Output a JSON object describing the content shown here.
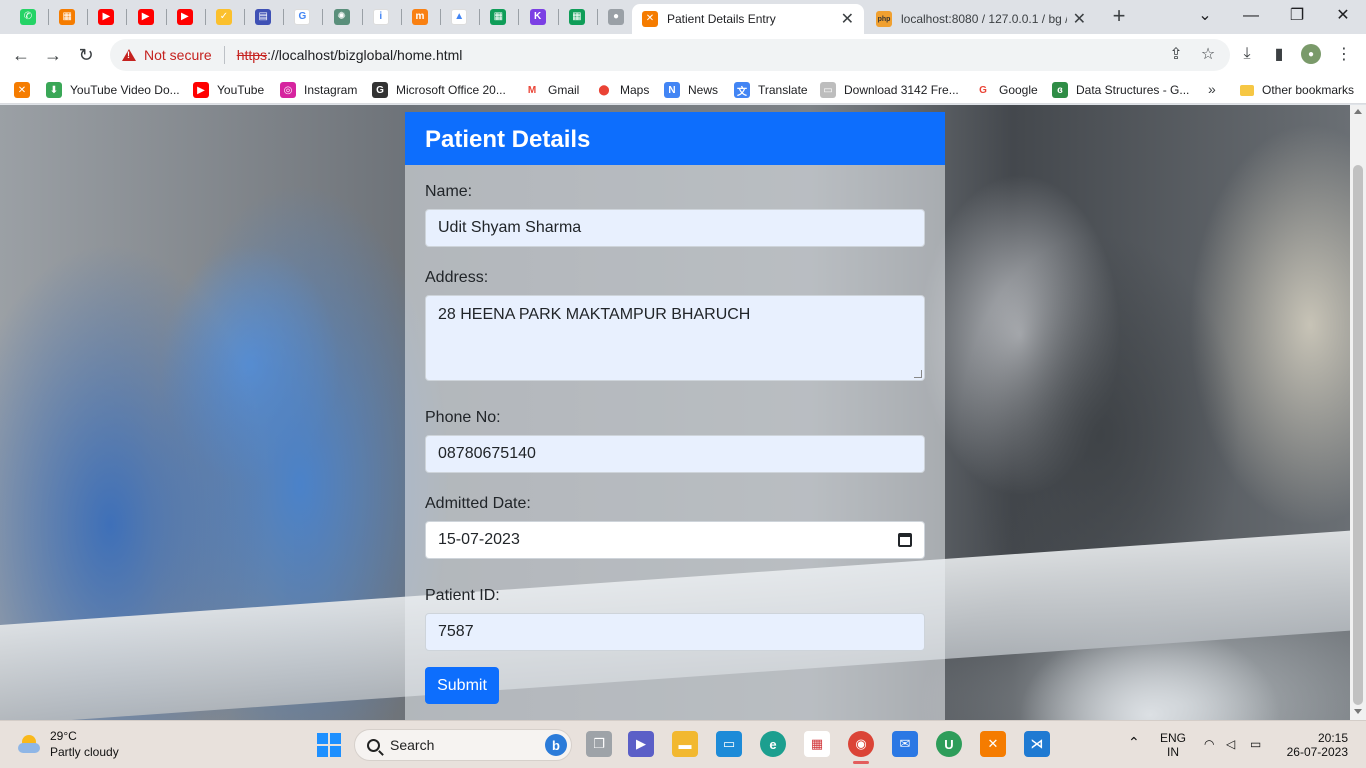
{
  "browser": {
    "pinned_tabs": [
      {
        "icon": "whatsapp-icon",
        "color": "#25d366",
        "glyph": "✆"
      },
      {
        "icon": "grid-app-icon",
        "color": "#f57c00",
        "glyph": "▦"
      },
      {
        "icon": "youtube-icon",
        "color": "#ff0000",
        "glyph": "▶"
      },
      {
        "icon": "youtube-icon",
        "color": "#ff0000",
        "glyph": "▶"
      },
      {
        "icon": "youtube-icon",
        "color": "#ff0000",
        "glyph": "▶"
      },
      {
        "icon": "check-icon",
        "color": "#fbc02d",
        "glyph": "✓"
      },
      {
        "icon": "calendar-app-icon",
        "color": "#3f51b5",
        "glyph": "▤"
      },
      {
        "icon": "google-icon",
        "color": "#ffffff",
        "glyph": "G"
      },
      {
        "icon": "openai-icon",
        "color": "#5a8f7b",
        "glyph": "✺"
      },
      {
        "icon": "iirs-icon",
        "color": "#ffffff",
        "glyph": "i"
      },
      {
        "icon": "moodle-icon",
        "color": "#f98012",
        "glyph": "m"
      },
      {
        "icon": "drive-icon",
        "color": "#ffffff",
        "glyph": "▲"
      },
      {
        "icon": "sheets-icon",
        "color": "#0f9d58",
        "glyph": "▦"
      },
      {
        "icon": "k-app-icon",
        "color": "#7b3fe4",
        "glyph": "K"
      },
      {
        "icon": "sheets-icon",
        "color": "#0f9d58",
        "glyph": "▦"
      },
      {
        "icon": "github-icon",
        "color": "#9aa0a6",
        "glyph": "●"
      }
    ],
    "active_tab_title": "Patient Details Entry",
    "second_tab_title": "localhost:8080 / 127.0.0.1 / bg /",
    "new_tab": "+",
    "window_controls": {
      "minimize": "—",
      "restore": "❐",
      "close": "✕",
      "tab_search": "⌄"
    },
    "nav": {
      "back": "←",
      "forward": "→",
      "reload": "↻"
    },
    "address": {
      "security_label": "Not secure",
      "scheme": "https",
      "rest": "://localhost/bizglobal/home.html"
    },
    "bookmarks": [
      {
        "label": "YouTube Video Do...",
        "icon": "download-arrow-icon",
        "color": "#3aa757",
        "glyph": "⬇"
      },
      {
        "label": "YouTube",
        "icon": "youtube-icon",
        "color": "#ff0000",
        "glyph": "▶"
      },
      {
        "label": "Instagram",
        "icon": "instagram-icon",
        "color": "#d6249f",
        "glyph": "◎"
      },
      {
        "label": "Microsoft Office 20...",
        "icon": "office-g-icon",
        "color": "#333333",
        "glyph": "G"
      },
      {
        "label": "Gmail",
        "icon": "gmail-icon",
        "color": "#ffffff",
        "glyph": "M"
      },
      {
        "label": "Maps",
        "icon": "maps-pin-icon",
        "color": "#ffffff",
        "glyph": "⬤"
      },
      {
        "label": "News",
        "icon": "news-icon",
        "color": "#4285f4",
        "glyph": "N"
      },
      {
        "label": "Translate",
        "icon": "translate-icon",
        "color": "#4285f4",
        "glyph": "文"
      },
      {
        "label": "Download 3142 Fre...",
        "icon": "page-icon",
        "color": "#bdbdbd",
        "glyph": "▭"
      },
      {
        "label": "Google",
        "icon": "google-icon",
        "color": "#ffffff",
        "glyph": "G"
      },
      {
        "label": "Data Structures - G...",
        "icon": "gfg-icon",
        "color": "#2f8d46",
        "glyph": "ɞ"
      }
    ],
    "more_bookmarks": "»",
    "other_bookmarks": "Other bookmarks"
  },
  "page": {
    "header_title": "Patient Details",
    "name_label": "Name:",
    "name_value": "Udit Shyam Sharma",
    "address_label": "Address:",
    "address_value": "28 HEENA PARK MAKTAMPUR BHARUCH",
    "phone_label": "Phone No:",
    "phone_value": "08780675140",
    "date_label": "Admitted Date:",
    "date_value": "15-07-2023",
    "pid_label": "Patient ID:",
    "pid_value": "7587",
    "submit_label": "Submit",
    "accent_color": "#0d6efd"
  },
  "taskbar": {
    "weather_temp": "29°C",
    "weather_desc": "Partly cloudy",
    "search_label": "Search",
    "lang_top": "ENG",
    "lang_bottom": "IN",
    "time": "20:15",
    "date": "26-07-2023",
    "chevron": "⌃"
  }
}
